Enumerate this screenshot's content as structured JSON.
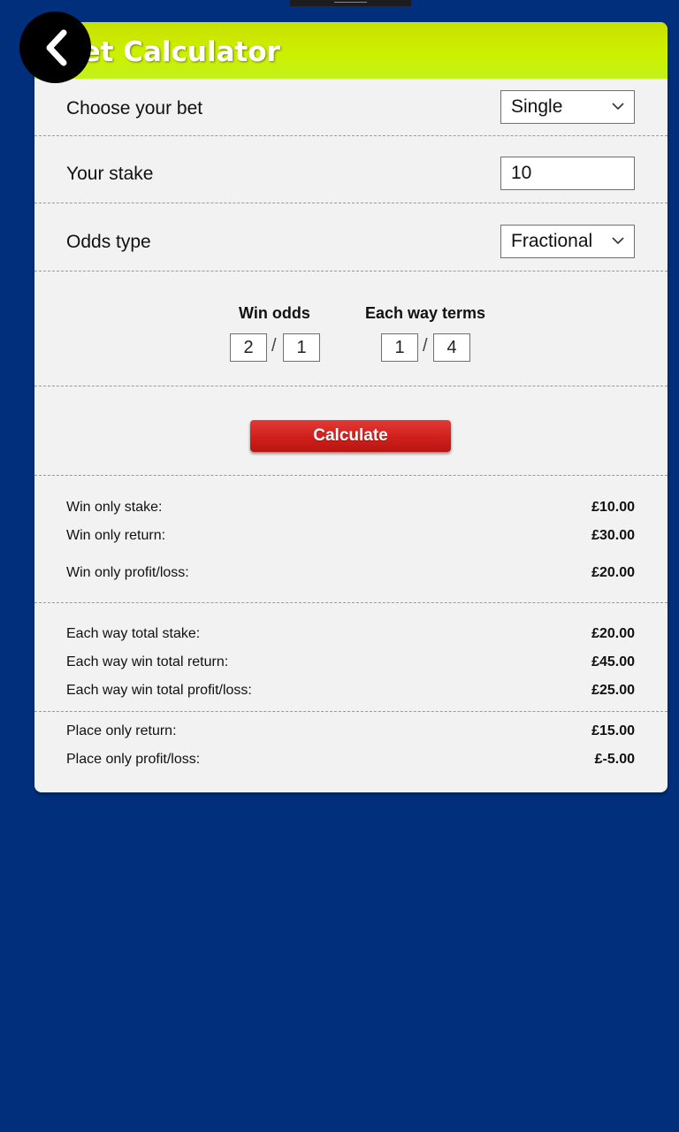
{
  "header": {
    "title": "Bet Calculator",
    "back_icon": "chevron-left-icon"
  },
  "form": {
    "bet_label": "Choose your bet",
    "bet_value": "Single",
    "stake_label": "Your stake",
    "stake_value": "10",
    "odds_type_label": "Odds type",
    "odds_type_value": "Fractional"
  },
  "odds": {
    "win_title": "Win odds",
    "win_num": "2",
    "win_den": "1",
    "each_way_title": "Each way terms",
    "ew_num": "1",
    "ew_den": "4",
    "separator": "/"
  },
  "actions": {
    "calculate_label": "Calculate"
  },
  "results": {
    "win": [
      {
        "label": "Win only stake:",
        "value": "£10.00"
      },
      {
        "label": "Win only return:",
        "value": "£30.00"
      },
      {
        "label": "Win only profit/loss:",
        "value": "£20.00"
      }
    ],
    "each_way": [
      {
        "label": "Each way total stake:",
        "value": "£20.00"
      },
      {
        "label": "Each way win total return:",
        "value": "£45.00"
      },
      {
        "label": "Each way win total profit/loss:",
        "value": "£25.00"
      }
    ],
    "place": [
      {
        "label": "Place only return:",
        "value": "£15.00"
      },
      {
        "label": "Place only profit/loss:",
        "value": "£-5.00"
      }
    ]
  },
  "colors": {
    "background": "#012f7c",
    "header_green": "#cdf000",
    "button_red": "#d01f1b",
    "card": "#f2f2f2"
  }
}
